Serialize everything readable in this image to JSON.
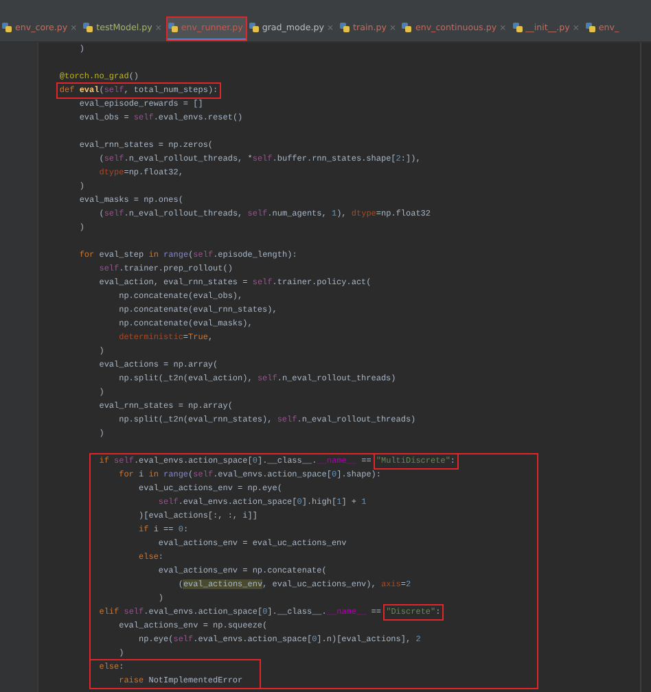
{
  "tabs": [
    {
      "label": "env_core.py",
      "close": "×",
      "selected": false,
      "boxed": false,
      "color": "#c56b5c"
    },
    {
      "label": "testModel.py",
      "close": "×",
      "selected": false,
      "boxed": false,
      "color": "#a3b26a"
    },
    {
      "label": "env_runner.py",
      "selected": true,
      "boxed": true,
      "color": "#c9594c"
    },
    {
      "label": "grad_mode.py",
      "close": "×",
      "selected": false,
      "boxed": false,
      "color": "#bbbbbb"
    },
    {
      "label": "train.py",
      "close": "×",
      "selected": false,
      "boxed": false,
      "color": "#d06a58"
    },
    {
      "label": "env_continuous.py",
      "close": "×",
      "selected": false,
      "boxed": false,
      "color": "#c9645a"
    },
    {
      "label": "__init__.py",
      "close": "×",
      "selected": false,
      "boxed": false,
      "color": "#c56b5c"
    },
    {
      "label": "env_",
      "selected": false,
      "boxed": false,
      "color": "#c56b5c"
    }
  ],
  "code": {
    "sections": [
      {
        "boxed": false,
        "lines": [
          {
            "kind": "code",
            "tokens": [
              {
                "text": "        )",
                "kind": "plain"
              }
            ]
          },
          {
            "kind": "blank"
          },
          {
            "kind": "code",
            "tokens": [
              {
                "text": "    @torch.no_grad",
                "kind": "decorator"
              },
              {
                "text": "()",
                "kind": "plain"
              }
            ]
          },
          {
            "kind": "code",
            "tokens": [
              {
                "text": "    def ",
                "kind": "keyword",
                "boxed": true
              },
              {
                "text": "eval",
                "kind": "function",
                "boxed": true
              },
              {
                "text": "(",
                "kind": "plain",
                "boxed": true
              },
              {
                "text": "self",
                "kind": "self",
                "boxed": true
              },
              {
                "text": ", total_num_steps):",
                "kind": "plain",
                "boxed": true
              }
            ]
          },
          {
            "kind": "code",
            "tokens": [
              {
                "text": "        eval_episode_rewards = []",
                "kind": "plain"
              }
            ]
          },
          {
            "kind": "code",
            "tokens": [
              {
                "text": "        eval_obs = ",
                "kind": "plain"
              },
              {
                "text": "self",
                "kind": "self"
              },
              {
                "text": ".eval_envs.reset()",
                "kind": "plain"
              }
            ]
          },
          {
            "kind": "blank"
          },
          {
            "kind": "code",
            "tokens": [
              {
                "text": "        eval_rnn_states = np.zeros(",
                "kind": "plain"
              }
            ]
          },
          {
            "kind": "code",
            "tokens": [
              {
                "text": "            (",
                "kind": "plain"
              },
              {
                "text": "self",
                "kind": "self"
              },
              {
                "text": ".n_eval_rollout_threads, *",
                "kind": "plain"
              },
              {
                "text": "self",
                "kind": "self"
              },
              {
                "text": ".buffer.rnn_states.shape[",
                "kind": "plain"
              },
              {
                "text": "2",
                "kind": "number"
              },
              {
                "text": ":]),",
                "kind": "plain"
              }
            ]
          },
          {
            "kind": "code",
            "tokens": [
              {
                "text": "            dtype",
                "kind": "param"
              },
              {
                "text": "=np.float32,",
                "kind": "plain"
              }
            ]
          },
          {
            "kind": "code",
            "tokens": [
              {
                "text": "        )",
                "kind": "plain"
              }
            ]
          },
          {
            "kind": "code",
            "tokens": [
              {
                "text": "        eval_masks = np.ones(",
                "kind": "plain"
              }
            ]
          },
          {
            "kind": "code",
            "tokens": [
              {
                "text": "            (",
                "kind": "plain"
              },
              {
                "text": "self",
                "kind": "self"
              },
              {
                "text": ".n_eval_rollout_threads, ",
                "kind": "plain"
              },
              {
                "text": "self",
                "kind": "self"
              },
              {
                "text": ".num_agents, ",
                "kind": "plain"
              },
              {
                "text": "1",
                "kind": "number"
              },
              {
                "text": "), ",
                "kind": "plain"
              },
              {
                "text": "dtype",
                "kind": "param"
              },
              {
                "text": "=np.float32",
                "kind": "plain"
              }
            ]
          },
          {
            "kind": "code",
            "tokens": [
              {
                "text": "        )",
                "kind": "plain"
              }
            ]
          },
          {
            "kind": "blank"
          },
          {
            "kind": "code",
            "tokens": [
              {
                "text": "        for ",
                "kind": "keyword"
              },
              {
                "text": "eval_step ",
                "kind": "plain"
              },
              {
                "text": "in ",
                "kind": "keyword"
              },
              {
                "text": "range",
                "kind": "builtin"
              },
              {
                "text": "(",
                "kind": "plain"
              },
              {
                "text": "self",
                "kind": "self"
              },
              {
                "text": ".episode_length):",
                "kind": "plain"
              }
            ]
          },
          {
            "kind": "code",
            "tokens": [
              {
                "text": "            self",
                "kind": "self"
              },
              {
                "text": ".trainer.prep_rollout()",
                "kind": "plain"
              }
            ]
          },
          {
            "kind": "code",
            "tokens": [
              {
                "text": "            eval_action, eval_rnn_states = ",
                "kind": "plain"
              },
              {
                "text": "self",
                "kind": "self"
              },
              {
                "text": ".trainer.policy.act(",
                "kind": "plain"
              }
            ]
          },
          {
            "kind": "code",
            "tokens": [
              {
                "text": "                np.concatenate(eval_obs),",
                "kind": "plain"
              }
            ]
          },
          {
            "kind": "code",
            "tokens": [
              {
                "text": "                np.concatenate(eval_rnn_states),",
                "kind": "plain"
              }
            ]
          },
          {
            "kind": "code",
            "tokens": [
              {
                "text": "                np.concatenate(eval_masks),",
                "kind": "plain"
              }
            ]
          },
          {
            "kind": "code",
            "tokens": [
              {
                "text": "                deterministic",
                "kind": "param"
              },
              {
                "text": "=",
                "kind": "plain"
              },
              {
                "text": "True",
                "kind": "keyword"
              },
              {
                "text": ",",
                "kind": "plain"
              }
            ]
          },
          {
            "kind": "code",
            "tokens": [
              {
                "text": "            )",
                "kind": "plain"
              }
            ]
          },
          {
            "kind": "code",
            "tokens": [
              {
                "text": "            eval_actions = np.array(",
                "kind": "plain"
              }
            ]
          },
          {
            "kind": "code",
            "tokens": [
              {
                "text": "                np.split(_t2n(eval_action), ",
                "kind": "plain"
              },
              {
                "text": "self",
                "kind": "self"
              },
              {
                "text": ".n_eval_rollout_threads)",
                "kind": "plain"
              }
            ]
          },
          {
            "kind": "code",
            "tokens": [
              {
                "text": "            )",
                "kind": "plain"
              }
            ]
          },
          {
            "kind": "code",
            "tokens": [
              {
                "text": "            eval_rnn_states = np.array(",
                "kind": "plain"
              }
            ]
          },
          {
            "kind": "code",
            "tokens": [
              {
                "text": "                np.split(_t2n(eval_rnn_states), ",
                "kind": "plain"
              },
              {
                "text": "self",
                "kind": "self"
              },
              {
                "text": ".n_eval_rollout_threads)",
                "kind": "plain"
              }
            ]
          },
          {
            "kind": "code",
            "tokens": [
              {
                "text": "            )",
                "kind": "plain"
              }
            ]
          },
          {
            "kind": "blank"
          }
        ]
      },
      {
        "boxed": true,
        "sections": [
          {
            "boxed": false,
            "lines": [
              {
                "kind": "code",
                "tokens": [
                  {
                    "text": "            if ",
                    "kind": "keyword"
                  },
                  {
                    "text": "self",
                    "kind": "self"
                  },
                  {
                    "text": ".eval_envs.action_space[",
                    "kind": "plain"
                  },
                  {
                    "text": "0",
                    "kind": "number"
                  },
                  {
                    "text": "].__class__.",
                    "kind": "plain"
                  },
                  {
                    "text": "__name__",
                    "kind": "dunder"
                  },
                  {
                    "text": " == ",
                    "kind": "plain"
                  },
                  {
                    "text": "\"MultiDiscrete\"",
                    "kind": "string",
                    "boxed": true
                  },
                  {
                    "text": ":",
                    "kind": "plain",
                    "boxed": true
                  }
                ]
              },
              {
                "kind": "code",
                "tokens": [
                  {
                    "text": "                for ",
                    "kind": "keyword"
                  },
                  {
                    "text": "i ",
                    "kind": "plain"
                  },
                  {
                    "text": "in ",
                    "kind": "keyword"
                  },
                  {
                    "text": "range",
                    "kind": "builtin"
                  },
                  {
                    "text": "(",
                    "kind": "plain"
                  },
                  {
                    "text": "self",
                    "kind": "self"
                  },
                  {
                    "text": ".eval_envs.action_space[",
                    "kind": "plain"
                  },
                  {
                    "text": "0",
                    "kind": "number"
                  },
                  {
                    "text": "].shape):",
                    "kind": "plain"
                  }
                ]
              },
              {
                "kind": "code",
                "tokens": [
                  {
                    "text": "                    eval_uc_actions_env = np.eye(",
                    "kind": "plain"
                  }
                ]
              },
              {
                "kind": "code",
                "tokens": [
                  {
                    "text": "                        self",
                    "kind": "self"
                  },
                  {
                    "text": ".eval_envs.action_space[",
                    "kind": "plain"
                  },
                  {
                    "text": "0",
                    "kind": "number"
                  },
                  {
                    "text": "].high[",
                    "kind": "plain"
                  },
                  {
                    "text": "1",
                    "kind": "number"
                  },
                  {
                    "text": "] + ",
                    "kind": "plain"
                  },
                  {
                    "text": "1",
                    "kind": "number"
                  }
                ]
              },
              {
                "kind": "code",
                "tokens": [
                  {
                    "text": "                    )[eval_actions[:, :, i]]",
                    "kind": "plain"
                  }
                ]
              },
              {
                "kind": "code",
                "tokens": [
                  {
                    "text": "                    if ",
                    "kind": "keyword"
                  },
                  {
                    "text": "i == ",
                    "kind": "plain"
                  },
                  {
                    "text": "0",
                    "kind": "number"
                  },
                  {
                    "text": ":",
                    "kind": "plain"
                  }
                ]
              },
              {
                "kind": "code",
                "tokens": [
                  {
                    "text": "                        eval_actions_env = eval_uc_actions_env",
                    "kind": "plain"
                  }
                ]
              },
              {
                "kind": "code",
                "tokens": [
                  {
                    "text": "                    else",
                    "kind": "keyword"
                  },
                  {
                    "text": ":",
                    "kind": "plain"
                  }
                ]
              },
              {
                "kind": "code",
                "tokens": [
                  {
                    "text": "                        eval_actions_env = np.concatenate(",
                    "kind": "plain"
                  }
                ]
              },
              {
                "kind": "code",
                "tokens": [
                  {
                    "text": "                            (",
                    "kind": "plain"
                  },
                  {
                    "text": "eval_actions_env",
                    "kind": "match"
                  },
                  {
                    "text": ", eval_uc_actions_env), ",
                    "kind": "plain"
                  },
                  {
                    "text": "axis",
                    "kind": "param"
                  },
                  {
                    "text": "=",
                    "kind": "plain"
                  },
                  {
                    "text": "2",
                    "kind": "number"
                  }
                ]
              },
              {
                "kind": "code",
                "tokens": [
                  {
                    "text": "                        )",
                    "kind": "plain"
                  }
                ]
              },
              {
                "kind": "code",
                "tokens": [
                  {
                    "text": "            elif ",
                    "kind": "keyword"
                  },
                  {
                    "text": "self",
                    "kind": "self"
                  },
                  {
                    "text": ".eval_envs.action_space[",
                    "kind": "plain"
                  },
                  {
                    "text": "0",
                    "kind": "number"
                  },
                  {
                    "text": "].__class__.",
                    "kind": "plain"
                  },
                  {
                    "text": "__name__",
                    "kind": "dunder"
                  },
                  {
                    "text": " == ",
                    "kind": "plain"
                  },
                  {
                    "text": "\"Discrete\"",
                    "kind": "string",
                    "boxed": true
                  },
                  {
                    "text": ":",
                    "kind": "plain",
                    "boxed": true
                  }
                ]
              },
              {
                "kind": "code",
                "tokens": [
                  {
                    "text": "                eval_actions_env = np.squeeze(",
                    "kind": "plain"
                  }
                ]
              },
              {
                "kind": "code",
                "tokens": [
                  {
                    "text": "                    np.eye(",
                    "kind": "plain"
                  },
                  {
                    "text": "self",
                    "kind": "self"
                  },
                  {
                    "text": ".eval_envs.action_space[",
                    "kind": "plain"
                  },
                  {
                    "text": "0",
                    "kind": "number"
                  },
                  {
                    "text": "].n)[eval_actions], ",
                    "kind": "plain"
                  },
                  {
                    "text": "2",
                    "kind": "number"
                  }
                ]
              },
              {
                "kind": "code",
                "tokens": [
                  {
                    "text": "                )",
                    "kind": "plain"
                  }
                ]
              }
            ]
          },
          {
            "boxed": true,
            "lines": [
              {
                "kind": "code",
                "tokens": [
                  {
                    "text": "            else",
                    "kind": "keyword"
                  },
                  {
                    "text": ":",
                    "kind": "plain"
                  }
                ]
              },
              {
                "kind": "code",
                "tokens": [
                  {
                    "text": "                raise ",
                    "kind": "keyword"
                  },
                  {
                    "text": "NotImplementedError",
                    "kind": "plain"
                  }
                ]
              }
            ]
          }
        ]
      }
    ]
  }
}
